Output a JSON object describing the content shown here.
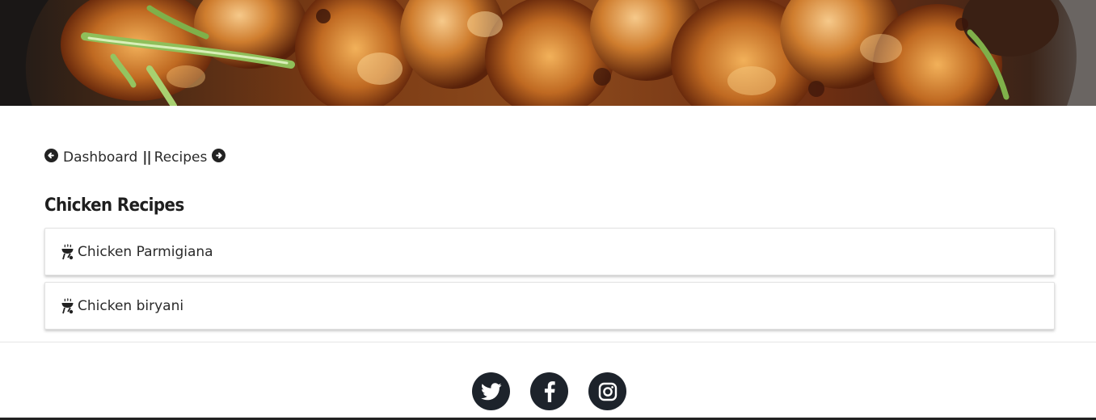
{
  "hero": {
    "image_description": "",
    "accent": "#b45a1c"
  },
  "nav": {
    "back_icon": "arrow-circle-left-icon",
    "dashboard_label": "Dashboard",
    "separator": "||",
    "recipes_label": "Recipes",
    "forward_icon": "arrow-circle-right-icon"
  },
  "section": {
    "title": "Chicken Recipes"
  },
  "recipes": [
    {
      "icon": "grill-icon",
      "label": "Chicken Parmigiana"
    },
    {
      "icon": "grill-icon",
      "label": "Chicken biryani"
    }
  ],
  "footer": {
    "socials": [
      {
        "name": "twitter-icon"
      },
      {
        "name": "facebook-icon"
      },
      {
        "name": "instagram-icon"
      }
    ],
    "icon_bg": "#1d232b"
  }
}
